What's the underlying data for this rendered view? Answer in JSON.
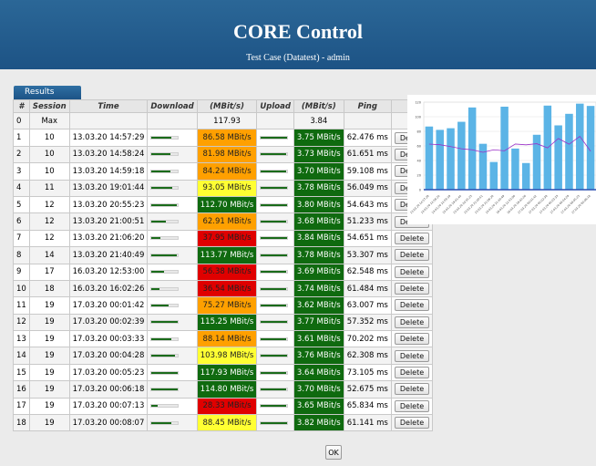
{
  "header": {
    "title": "CORE Control",
    "subtitle": "Test Case (Datatest) - admin"
  },
  "tab_label": "Results",
  "table": {
    "headers": [
      "#",
      "Session",
      "Time",
      "Download",
      "(MBit/s)",
      "Upload",
      "(MBit/s)",
      "Ping",
      ""
    ],
    "max_row": {
      "index": "0",
      "session": "Max",
      "download": "117.93",
      "upload": "3.84"
    },
    "rows": [
      {
        "index": "1",
        "session": "10",
        "time": "13.03.20 14:57:29",
        "download": "86.58 MBit/s",
        "dl_val": 86.58,
        "dl_color": "orange",
        "upload": "3.75 MBit/s",
        "ul_val": 3.75,
        "ping": "62.476 ms"
      },
      {
        "index": "2",
        "session": "10",
        "time": "13.03.20 14:58:24",
        "download": "81.98 MBit/s",
        "dl_val": 81.98,
        "dl_color": "orange",
        "upload": "3.73 MBit/s",
        "ul_val": 3.73,
        "ping": "61.651 ms"
      },
      {
        "index": "3",
        "session": "10",
        "time": "13.03.20 14:59:18",
        "download": "84.24 MBit/s",
        "dl_val": 84.24,
        "dl_color": "orange",
        "upload": "3.70 MBit/s",
        "ul_val": 3.7,
        "ping": "59.108 ms"
      },
      {
        "index": "4",
        "session": "11",
        "time": "13.03.20 19:01:44",
        "download": "93.05 MBit/s",
        "dl_val": 93.05,
        "dl_color": "yellow",
        "upload": "3.78 MBit/s",
        "ul_val": 3.78,
        "ping": "56.049 ms"
      },
      {
        "index": "5",
        "session": "12",
        "time": "13.03.20 20:55:23",
        "download": "112.70 MBit/s",
        "dl_val": 112.7,
        "dl_color": "green",
        "upload": "3.80 MBit/s",
        "ul_val": 3.8,
        "ping": "54.643 ms"
      },
      {
        "index": "6",
        "session": "12",
        "time": "13.03.20 21:00:51",
        "download": "62.91 MBit/s",
        "dl_val": 62.91,
        "dl_color": "orange",
        "upload": "3.68 MBit/s",
        "ul_val": 3.68,
        "ping": "51.233 ms"
      },
      {
        "index": "7",
        "session": "12",
        "time": "13.03.20 21:06:20",
        "download": "37.95 MBit/s",
        "dl_val": 37.95,
        "dl_color": "red",
        "upload": "3.84 MBit/s",
        "ul_val": 3.84,
        "ping": "54.651 ms"
      },
      {
        "index": "8",
        "session": "14",
        "time": "13.03.20 21:40:49",
        "download": "113.77 MBit/s",
        "dl_val": 113.77,
        "dl_color": "green",
        "upload": "3.78 MBit/s",
        "ul_val": 3.78,
        "ping": "53.307 ms"
      },
      {
        "index": "9",
        "session": "17",
        "time": "16.03.20 12:53:00",
        "download": "56.38 MBit/s",
        "dl_val": 56.38,
        "dl_color": "red",
        "upload": "3.69 MBit/s",
        "ul_val": 3.69,
        "ping": "62.548 ms"
      },
      {
        "index": "10",
        "session": "18",
        "time": "16.03.20 16:02:26",
        "download": "36.54 MBit/s",
        "dl_val": 36.54,
        "dl_color": "red",
        "upload": "3.74 MBit/s",
        "ul_val": 3.74,
        "ping": "61.484 ms"
      },
      {
        "index": "11",
        "session": "19",
        "time": "17.03.20 00:01:42",
        "download": "75.27 MBit/s",
        "dl_val": 75.27,
        "dl_color": "orange",
        "upload": "3.62 MBit/s",
        "ul_val": 3.62,
        "ping": "63.007 ms"
      },
      {
        "index": "12",
        "session": "19",
        "time": "17.03.20 00:02:39",
        "download": "115.25 MBit/s",
        "dl_val": 115.25,
        "dl_color": "green",
        "upload": "3.77 MBit/s",
        "ul_val": 3.77,
        "ping": "57.352 ms"
      },
      {
        "index": "13",
        "session": "19",
        "time": "17.03.20 00:03:33",
        "download": "88.14 MBit/s",
        "dl_val": 88.14,
        "dl_color": "orange",
        "upload": "3.61 MBit/s",
        "ul_val": 3.61,
        "ping": "70.202 ms"
      },
      {
        "index": "14",
        "session": "19",
        "time": "17.03.20 00:04:28",
        "download": "103.98 MBit/s",
        "dl_val": 103.98,
        "dl_color": "yellow",
        "upload": "3.76 MBit/s",
        "ul_val": 3.76,
        "ping": "62.308 ms"
      },
      {
        "index": "15",
        "session": "19",
        "time": "17.03.20 00:05:23",
        "download": "117.93 MBit/s",
        "dl_val": 117.93,
        "dl_color": "green",
        "upload": "3.64 MBit/s",
        "ul_val": 3.64,
        "ping": "73.105 ms"
      },
      {
        "index": "16",
        "session": "19",
        "time": "17.03.20 00:06:18",
        "download": "114.80 MBit/s",
        "dl_val": 114.8,
        "dl_color": "green",
        "upload": "3.70 MBit/s",
        "ul_val": 3.7,
        "ping": "52.675 ms"
      },
      {
        "index": "17",
        "session": "19",
        "time": "17.03.20 00:07:13",
        "download": "28.33 MBit/s",
        "dl_val": 28.33,
        "dl_color": "red",
        "upload": "3.65 MBit/s",
        "ul_val": 3.65,
        "ping": "65.834 ms"
      },
      {
        "index": "18",
        "session": "19",
        "time": "17.03.20 00:08:07",
        "download": "88.45 MBit/s",
        "dl_val": 88.45,
        "dl_color": "yellow",
        "upload": "3.82 MBit/s",
        "ul_val": 3.82,
        "ping": "61.141 ms"
      }
    ],
    "delete_label": "Delete"
  },
  "ok_label": "OK",
  "colors": {
    "header": "#1d5385",
    "orange": "#ffa000",
    "yellow": "#ffff33",
    "red": "#e00000",
    "green": "#0f6a0f",
    "bar": "#5bb4e6",
    "line": "#9b30c8"
  },
  "chart_data": {
    "type": "bar",
    "yticks": [
      "0",
      "20",
      "40",
      "60",
      "80",
      "100",
      "120"
    ],
    "ylim": [
      0,
      120
    ],
    "categories": [
      "13.03.20 14:57:29",
      "13.03.20 14:58:24",
      "13.03.20 14:59:18",
      "13.03.20 19:01:44",
      "13.03.20 20:55:23",
      "13.03.20 21:00:51",
      "13.03.20 21:06:20",
      "13.03.20 21:40:49",
      "16.03.20 12:53:00",
      "16.03.20 16:02:26",
      "17.03.20 00:01:42",
      "17.03.20 00:02:39",
      "17.03.20 00:03:33",
      "17.03.20 00:04:28",
      "17.03.20 00:05:23",
      "17.03.20 00:06:18"
    ],
    "series": [
      {
        "values": [
          86.58,
          81.98,
          84.24,
          93.05,
          112.7,
          62.91,
          37.95,
          113.77,
          56.38,
          36.54,
          75.27,
          115.25,
          88.14,
          103.98,
          117.93,
          114.8
        ]
      },
      {
        "values": [
          62.476,
          61.651,
          59.108,
          56.049,
          54.643,
          51.233,
          54.651,
          53.307,
          62.548,
          61.484,
          63.007,
          57.352,
          70.202,
          62.308,
          73.105,
          52.675
        ]
      }
    ]
  }
}
